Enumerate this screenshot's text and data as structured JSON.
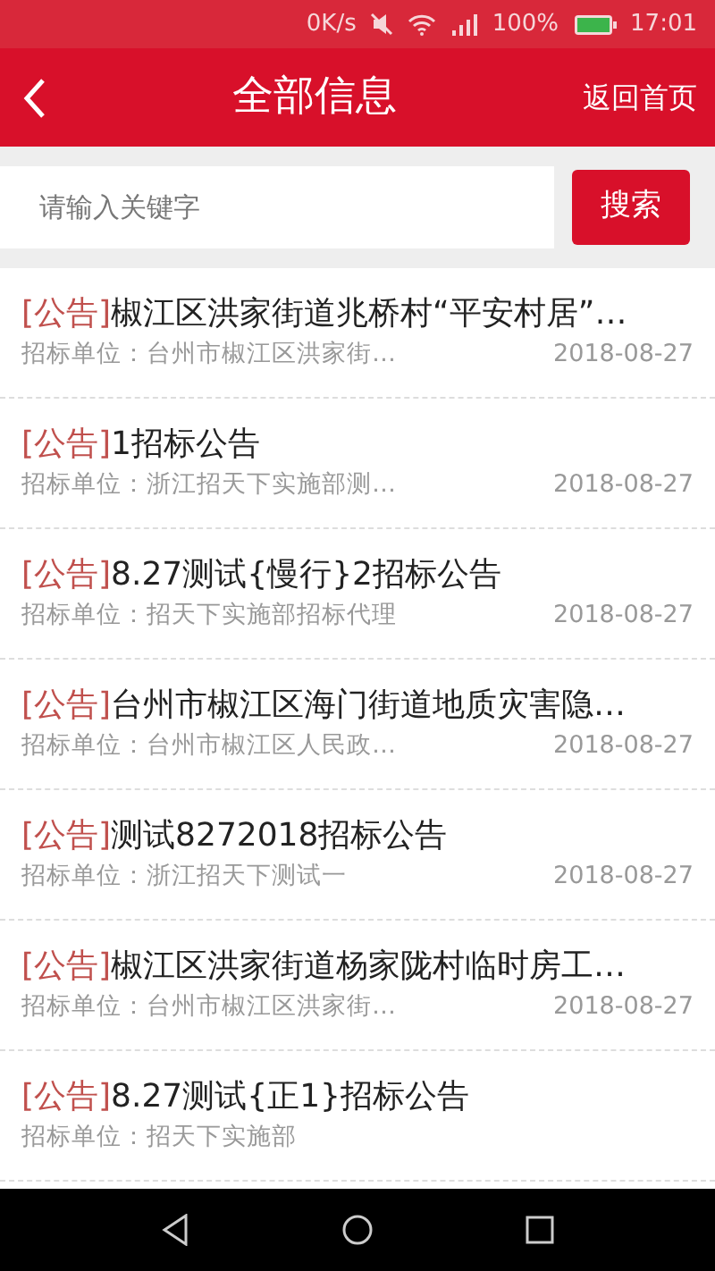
{
  "status_bar": {
    "speed": "0K/s",
    "battery_text": "100%",
    "time": "17:01"
  },
  "header": {
    "title": "全部信息",
    "home_link": "返回首页"
  },
  "search": {
    "placeholder": "请输入关键字",
    "button": "搜索"
  },
  "items": [
    {
      "tag": "[公告]",
      "title": "椒江区洪家街道兆桥村“平安村居”…",
      "unit": "招标单位：台州市椒江区洪家街…",
      "date": "2018-08-27"
    },
    {
      "tag": "[公告]",
      "title": "1招标公告",
      "unit": "招标单位：浙江招天下实施部测…",
      "date": "2018-08-27"
    },
    {
      "tag": "[公告]",
      "title": "8.27测试{慢行}2招标公告",
      "unit": "招标单位：招天下实施部招标代理",
      "date": "2018-08-27"
    },
    {
      "tag": "[公告]",
      "title": "台州市椒江区海门街道地质灾害隐…",
      "unit": "招标单位：台州市椒江区人民政…",
      "date": "2018-08-27"
    },
    {
      "tag": "[公告]",
      "title": "测试8272018招标公告",
      "unit": "招标单位：浙江招天下测试一",
      "date": "2018-08-27"
    },
    {
      "tag": "[公告]",
      "title": "椒江区洪家街道杨家陇村临时房工…",
      "unit": "招标单位：台州市椒江区洪家街…",
      "date": "2018-08-27"
    },
    {
      "tag": "[公告]",
      "title": "8.27测试{正1}招标公告",
      "unit": "招标单位：招天下实施部"
    }
  ]
}
